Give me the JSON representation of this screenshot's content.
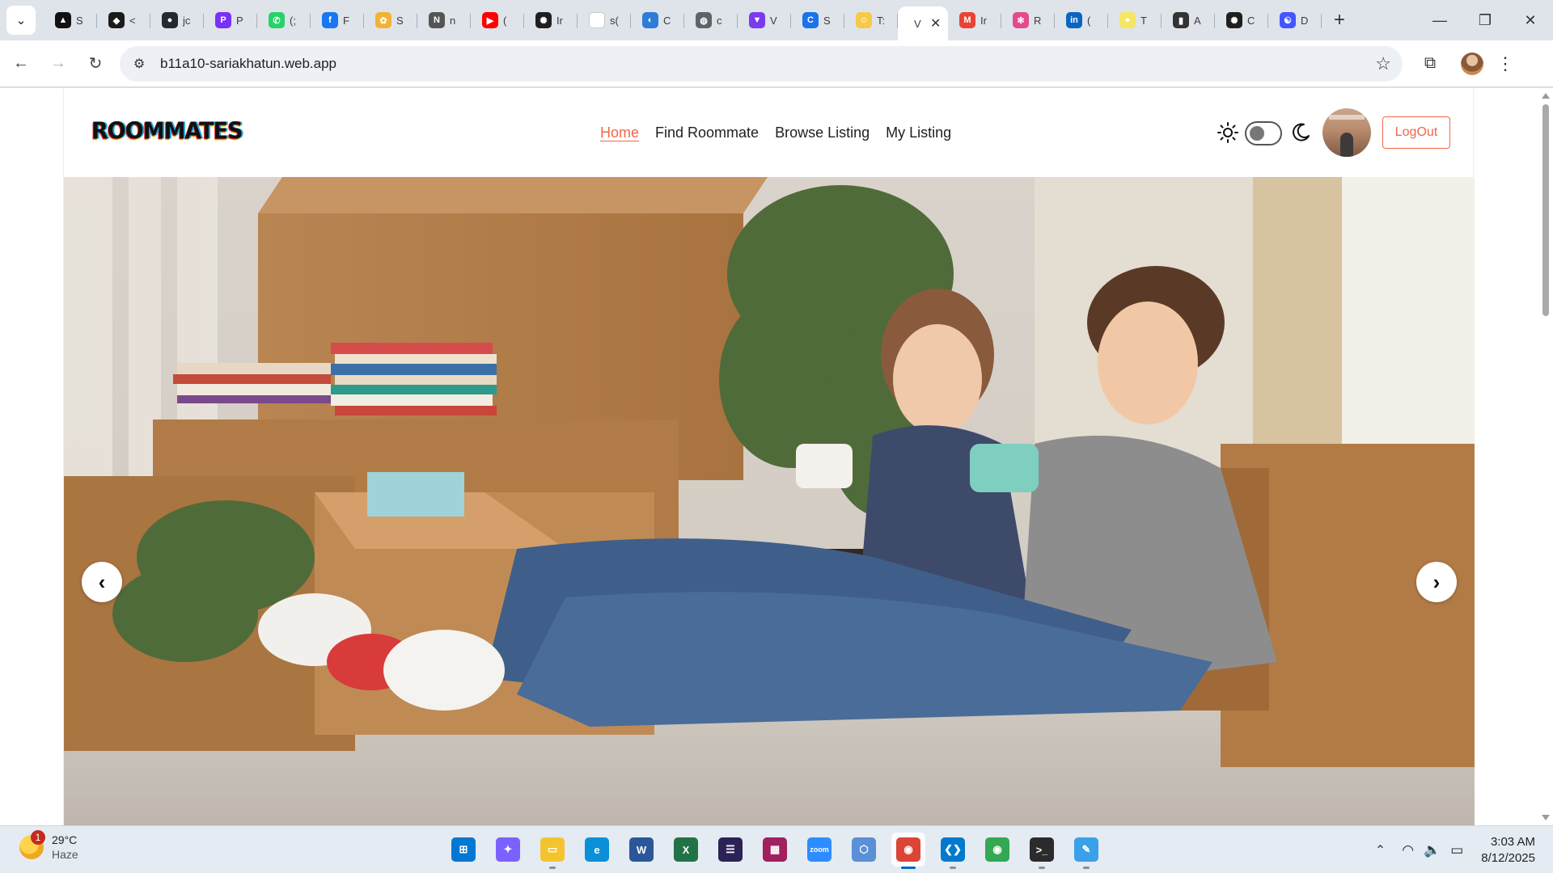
{
  "browser": {
    "tabs": [
      {
        "title": "S",
        "color": "#111111",
        "glyph": "▲"
      },
      {
        "title": "<",
        "color": "#1b1b1b",
        "glyph": "◆"
      },
      {
        "title": "jc",
        "color": "#24292f",
        "glyph": "●"
      },
      {
        "title": "P",
        "color": "#7b2ff7",
        "glyph": "P"
      },
      {
        "title": "(;",
        "color": "#25d366",
        "glyph": "✆"
      },
      {
        "title": "F",
        "color": "#1877f2",
        "glyph": "f"
      },
      {
        "title": "S",
        "color": "#f2b233",
        "glyph": "✿"
      },
      {
        "title": "n",
        "color": "#555555",
        "glyph": "N"
      },
      {
        "title": "(",
        "color": "#ff0000",
        "glyph": "▶"
      },
      {
        "title": "Ir",
        "color": "#1f1f1f",
        "glyph": "✺"
      },
      {
        "title": "s(",
        "color": "#ffffff",
        "glyph": ""
      },
      {
        "title": "C",
        "color": "#2f7cd6",
        "glyph": "◐"
      },
      {
        "title": "c",
        "color": "#5f6368",
        "glyph": "◍"
      },
      {
        "title": "V",
        "color": "#7c3aed",
        "glyph": "▼"
      },
      {
        "title": "S",
        "color": "#1a73e8",
        "glyph": "C"
      },
      {
        "title": "T:",
        "color": "#f7c948",
        "glyph": "☺"
      }
    ],
    "active_tab": {
      "title": "V",
      "close": "✕"
    },
    "tabs_after": [
      {
        "title": "Ir",
        "color": "#ea4335",
        "glyph": "M"
      },
      {
        "title": "R",
        "color": "#e34a8c",
        "glyph": "✻"
      },
      {
        "title": "(",
        "color": "#0a66c2",
        "glyph": "in"
      },
      {
        "title": "T",
        "color": "#f5e663",
        "glyph": "●"
      },
      {
        "title": "A",
        "color": "#333333",
        "glyph": "▮"
      },
      {
        "title": "C",
        "color": "#1f1f1f",
        "glyph": "✺"
      },
      {
        "title": "D",
        "color": "#4355ff",
        "glyph": "☯"
      }
    ],
    "new_tab": "+",
    "window": {
      "minimize": "—",
      "restore": "❐",
      "close": "✕"
    },
    "url": "b11a10-sariakhatun.web.app",
    "icons": {
      "back": "←",
      "forward": "→",
      "reload": "↻",
      "site_info": "⚙",
      "star": "☆",
      "extensions": "⧉",
      "menu": "⋮",
      "tab_search": "⌄"
    }
  },
  "site": {
    "logo": "ROOMMATES",
    "nav": [
      {
        "label": "Home",
        "active": true
      },
      {
        "label": "Find Roommate",
        "active": false
      },
      {
        "label": "Browse Listing",
        "active": false
      },
      {
        "label": "My Listing",
        "active": false
      }
    ],
    "theme_toggle": {
      "state": "light"
    },
    "logout_label": "LogOut",
    "carousel": {
      "prev": "‹",
      "next": "›"
    },
    "accent": "#f26649"
  },
  "taskbar": {
    "weather": {
      "temp": "29°C",
      "condition": "Haze",
      "badge": "1"
    },
    "apps": [
      {
        "name": "windows-start",
        "color": "#0078d4",
        "glyph": "⊞",
        "running": false
      },
      {
        "name": "copilot",
        "color": "#7b61ff",
        "glyph": "✦",
        "running": false
      },
      {
        "name": "file-explorer",
        "color": "#f4c430",
        "glyph": "▭",
        "running": true
      },
      {
        "name": "edge",
        "color": "#0c8fd9",
        "glyph": "e",
        "running": false
      },
      {
        "name": "word",
        "color": "#2b579a",
        "glyph": "W",
        "running": false
      },
      {
        "name": "excel",
        "color": "#217346",
        "glyph": "X",
        "running": false
      },
      {
        "name": "eclipse",
        "color": "#2c2255",
        "glyph": "☰",
        "running": false
      },
      {
        "name": "winrar",
        "color": "#a02060",
        "glyph": "▦",
        "running": false
      },
      {
        "name": "zoom",
        "color": "#2d8cff",
        "glyph": "zoom",
        "running": false
      },
      {
        "name": "virtualbox",
        "color": "#5b8fd6",
        "glyph": "⬡",
        "running": false
      },
      {
        "name": "chrome",
        "color": "#db4437",
        "glyph": "◉",
        "running": true
      },
      {
        "name": "vscode",
        "color": "#007acc",
        "glyph": "❮❯",
        "running": true
      },
      {
        "name": "chrome-beta",
        "color": "#34a853",
        "glyph": "◉",
        "running": false
      },
      {
        "name": "terminal",
        "color": "#2b2b2b",
        "glyph": ">_",
        "running": true
      },
      {
        "name": "paint",
        "color": "#3aa0e8",
        "glyph": "✎",
        "running": true
      }
    ],
    "tray": {
      "chevron": "⌃",
      "wifi": "◠",
      "volume": "🔈",
      "battery": "▭"
    },
    "time": "3:03 AM",
    "date": "8/12/2025"
  }
}
